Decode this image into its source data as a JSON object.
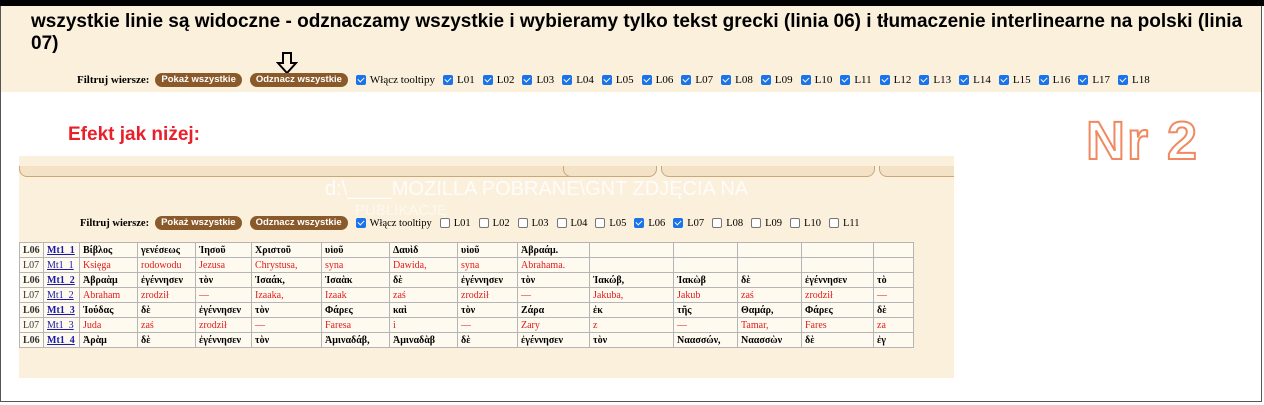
{
  "title": "wszystkie linie są widoczne - odznaczamy wszystkie i wybieramy tylko tekst grecki (linia 06) i tłumaczenie interlinearne na polski (linia 07)",
  "filter": {
    "label": "Filtruj wiersze:",
    "show_all": "Pokaż wszystkie",
    "uncheck_all": "Odznacz wszystkie",
    "tooltips": "Włącz tooltipy",
    "lines": [
      {
        "label": "L01",
        "checked": true
      },
      {
        "label": "L02",
        "checked": true
      },
      {
        "label": "L03",
        "checked": true
      },
      {
        "label": "L04",
        "checked": true
      },
      {
        "label": "L05",
        "checked": true
      },
      {
        "label": "L06",
        "checked": true
      },
      {
        "label": "L07",
        "checked": true
      },
      {
        "label": "L08",
        "checked": true
      },
      {
        "label": "L09",
        "checked": true
      },
      {
        "label": "L10",
        "checked": true
      },
      {
        "label": "L11",
        "checked": true
      },
      {
        "label": "L12",
        "checked": true
      },
      {
        "label": "L13",
        "checked": true
      },
      {
        "label": "L14",
        "checked": true
      },
      {
        "label": "L15",
        "checked": true
      },
      {
        "label": "L16",
        "checked": true
      },
      {
        "label": "L17",
        "checked": true
      },
      {
        "label": "L18",
        "checked": true
      }
    ]
  },
  "effect_label": "Efekt jak niżej:",
  "nr_label": "Nr 2",
  "screenshot": {
    "overlay_text": "d:\\____MOZILLA POBRANE\\GNT ZDJĘCIA NA",
    "overlay_text2": "PUBLIKACJĘ",
    "filter": {
      "label": "Filtruj wiersze:",
      "show_all": "Pokaż wszystkie",
      "uncheck_all": "Odznacz wszystkie",
      "tooltips": "Włącz tooltipy",
      "lines": [
        {
          "label": "L01",
          "checked": false
        },
        {
          "label": "L02",
          "checked": false
        },
        {
          "label": "L03",
          "checked": false
        },
        {
          "label": "L04",
          "checked": false
        },
        {
          "label": "L05",
          "checked": false
        },
        {
          "label": "L06",
          "checked": true
        },
        {
          "label": "L07",
          "checked": true
        },
        {
          "label": "L08",
          "checked": false
        },
        {
          "label": "L09",
          "checked": false
        },
        {
          "label": "L10",
          "checked": false
        },
        {
          "label": "L11",
          "checked": false
        }
      ]
    },
    "rows": [
      {
        "kind": "g",
        "code": "L06",
        "ref": "Mt1_1",
        "cells": [
          "Βίβλος",
          "γενέσεως",
          "Ἰησοῦ",
          "Χριστοῦ",
          "υἱοῦ",
          "Δαυὶδ",
          "υἱοῦ",
          "Ἀβραάμ.",
          "",
          "",
          "",
          "",
          ""
        ]
      },
      {
        "kind": "p",
        "code": "L07",
        "ref": "Mt1_1",
        "cells": [
          "Księga",
          "rodowodu",
          "Jezusa",
          "Chrystusa,",
          "syna",
          "Dawida,",
          "syna",
          "Abrahama.",
          "",
          "",
          "",
          "",
          ""
        ]
      },
      {
        "kind": "g",
        "code": "L06",
        "ref": "Mt1_2",
        "cells": [
          "Ἀβραὰμ",
          "ἐγέννησεν",
          "τὸν",
          "Ἰσαάκ,",
          "Ἰσαὰκ",
          "δὲ",
          "ἐγέννησεν",
          "τὸν",
          "Ἰακώβ,",
          "Ἰακὼβ",
          "δὲ",
          "ἐγέννησεν",
          "τὸ"
        ]
      },
      {
        "kind": "p",
        "code": "L07",
        "ref": "Mt1_2",
        "cells": [
          "Abraham",
          "zrodził",
          "—",
          "Izaaka,",
          "Izaak",
          "zaś",
          "zrodził",
          "—",
          "Jakuba,",
          "Jakub",
          "zaś",
          "zrodził",
          "—"
        ]
      },
      {
        "kind": "g",
        "code": "L06",
        "ref": "Mt1_3",
        "cells": [
          "Ἰούδας",
          "δὲ",
          "ἐγέννησεν",
          "τὸν",
          "Φάρες",
          "καὶ",
          "τὸν",
          "Ζάρα",
          "ἐκ",
          "τῆς",
          "Θαμάρ,",
          "Φάρες",
          "δὲ"
        ]
      },
      {
        "kind": "p",
        "code": "L07",
        "ref": "Mt1_3",
        "cells": [
          "Juda",
          "zaś",
          "zrodził",
          "—",
          "Faresa",
          "i",
          "—",
          "Zary",
          "z",
          "—",
          "Tamar,",
          "Fares",
          "za"
        ]
      },
      {
        "kind": "g",
        "code": "L06",
        "ref": "Mt1_4",
        "cells": [
          "Ἀρὰμ",
          "δὲ",
          "ἐγέννησεν",
          "τὸν",
          "Ἀμιναδάβ,",
          "Ἀμιναδὰβ",
          "δὲ",
          "ἐγέννησεν",
          "τὸν",
          "Ναασσών,",
          "Ναασσὼν",
          "δὲ",
          "ἐγ"
        ]
      }
    ]
  }
}
